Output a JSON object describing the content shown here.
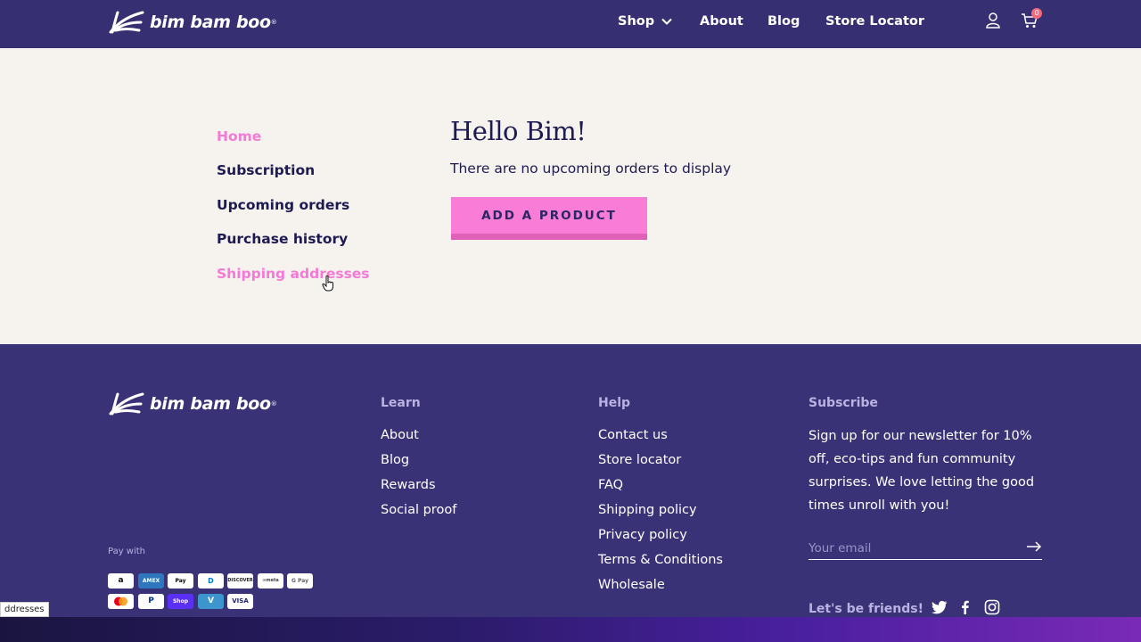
{
  "header": {
    "brand": "bim bam boo",
    "brand_mark": "®",
    "nav": [
      {
        "label": "Shop",
        "dropdown": true
      },
      {
        "label": "About"
      },
      {
        "label": "Blog"
      },
      {
        "label": "Store Locator"
      }
    ],
    "icons": [
      "user-icon",
      "cart-icon"
    ],
    "cart_count": "0"
  },
  "account_nav": {
    "items": [
      {
        "label": "Home",
        "state": "active"
      },
      {
        "label": "Subscription"
      },
      {
        "label": "Upcoming orders"
      },
      {
        "label": "Purchase history"
      },
      {
        "label": "Shipping addresses",
        "state": "hover"
      }
    ]
  },
  "main": {
    "greeting": "Hello Bim!",
    "message": "There are no upcoming orders to display",
    "add_product_label": "ADD A PRODUCT"
  },
  "footer": {
    "brand": "bim bam boo",
    "learn": {
      "heading": "Learn",
      "links": [
        "About",
        "Blog",
        "Rewards",
        "Social proof"
      ]
    },
    "help": {
      "heading": "Help",
      "links": [
        "Contact us",
        "Store locator",
        "FAQ",
        "Shipping policy",
        "Privacy policy",
        "Terms & Conditions",
        "Wholesale"
      ]
    },
    "subscribe": {
      "heading": "Subscribe",
      "text": "Sign up for our newsletter for 10% off, eco-tips and fun community surprises. We love letting the good times unroll with you!",
      "email_placeholder": "Your email"
    },
    "pay_with": "Pay with",
    "payment_methods": [
      "amazon",
      "amex",
      "Pay",
      "diners",
      "DISCOVER",
      "meta",
      "G Pay",
      "mastercard",
      "P",
      "Shop Pay",
      "V",
      "VISA"
    ],
    "friends_label": "Let's be friends!",
    "social": [
      "twitter-icon",
      "facebook-icon",
      "instagram-icon"
    ]
  },
  "status_tooltip": "ddresses",
  "colors": {
    "header_bg": "#362f72",
    "footer_bg": "#393276",
    "page_bg": "#f6f3ee",
    "accent_pink": "#f97dd6",
    "text_navy": "#1e1a52"
  }
}
